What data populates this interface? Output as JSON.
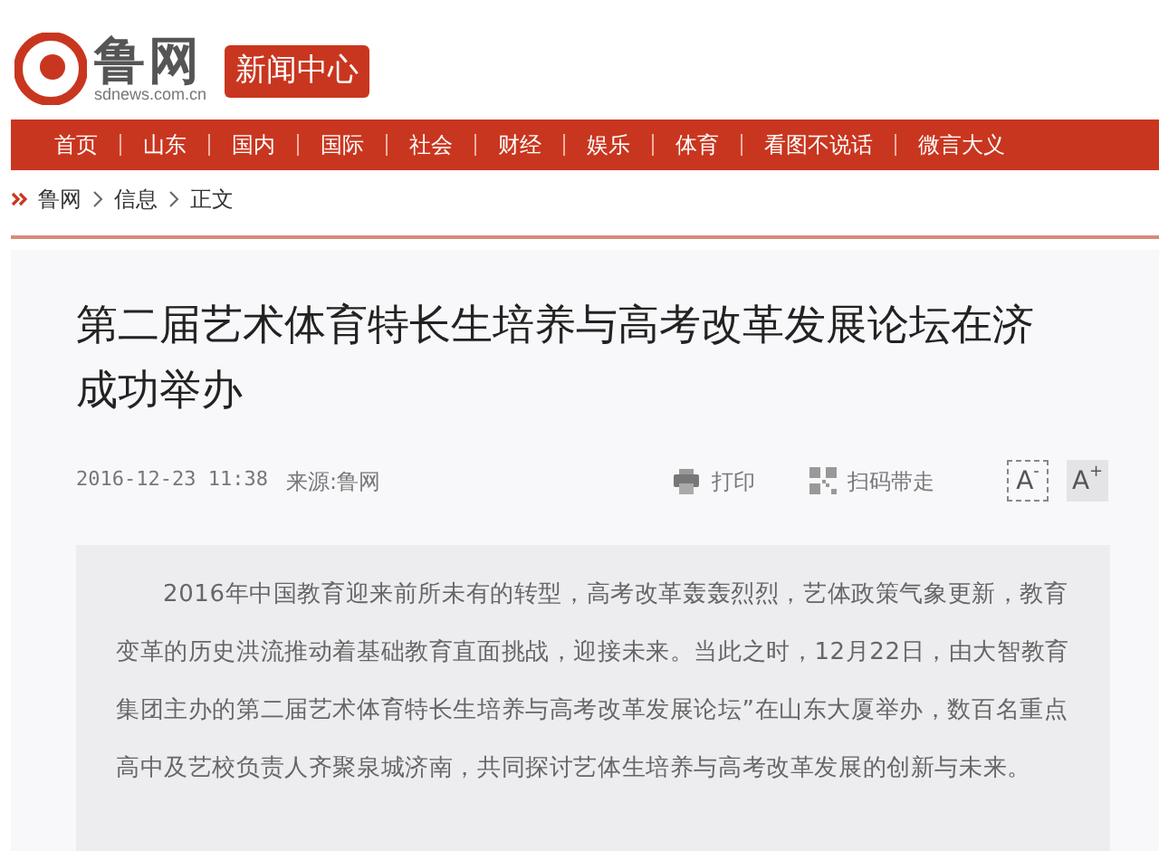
{
  "header": {
    "logo_text": "鲁网",
    "logo_domain": "sdnews.com.cn",
    "section_badge": "新闻中心"
  },
  "nav": [
    {
      "label": "首页"
    },
    {
      "label": "山东"
    },
    {
      "label": "国内"
    },
    {
      "label": "国际"
    },
    {
      "label": "社会"
    },
    {
      "label": "财经"
    },
    {
      "label": "娱乐"
    },
    {
      "label": "体育"
    },
    {
      "label": "看图不说话"
    },
    {
      "label": "微言大义"
    }
  ],
  "breadcrumb": [
    "鲁网",
    "信息",
    "正文"
  ],
  "article": {
    "title": "第二届艺术体育特长生培养与高考改革发展论坛在济成功举办",
    "date": "2016-12-23 11:38",
    "source": "来源:鲁网",
    "actions": [
      {
        "kind": "print",
        "label": "打印"
      },
      {
        "kind": "qr",
        "label": "扫码带走"
      }
    ],
    "font_buttons": [
      {
        "label": "A",
        "sign": "-",
        "selected": false
      },
      {
        "label": "A",
        "sign": "+",
        "selected": true
      }
    ],
    "summary": "2016年中国教育迎来前所未有的转型，高考改革轰轰烈烈，艺体政策气象更新，教育变革的历史洪流推动着基础教育直面挑战，迎接未来。当此之时，12月22日，由大智教育集团主办的第二届艺术体育特长生培养与高考改革发展论坛”在山东大厦举办，数百名重点高中及艺校负责人齐聚泉城济南，共同探讨艺体生培养与高考改革发展的创新与未来。"
  }
}
